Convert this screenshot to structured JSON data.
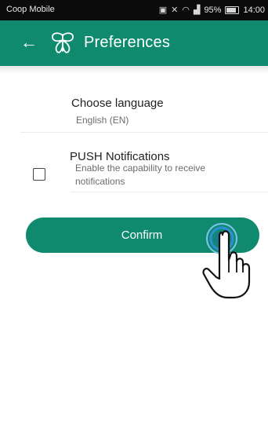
{
  "status_bar": {
    "carrier": "Coop Mobile",
    "battery": "95%",
    "time": "14:00"
  },
  "app_bar": {
    "title": "Preferences",
    "back_icon": "back-arrow-icon",
    "logo_icon": "butterfly-logo-icon",
    "color": "#0f8a6f"
  },
  "language": {
    "title": "Choose language",
    "value": "English (EN)"
  },
  "push": {
    "title": "PUSH Notifications",
    "description": "Enable the capability to receive notifications",
    "checked": false
  },
  "confirm_button": {
    "label": "Confirm"
  },
  "overlay": {
    "pointer_icon": "pointing-hand-icon",
    "touch_indicator": "tap-ring-icon"
  }
}
